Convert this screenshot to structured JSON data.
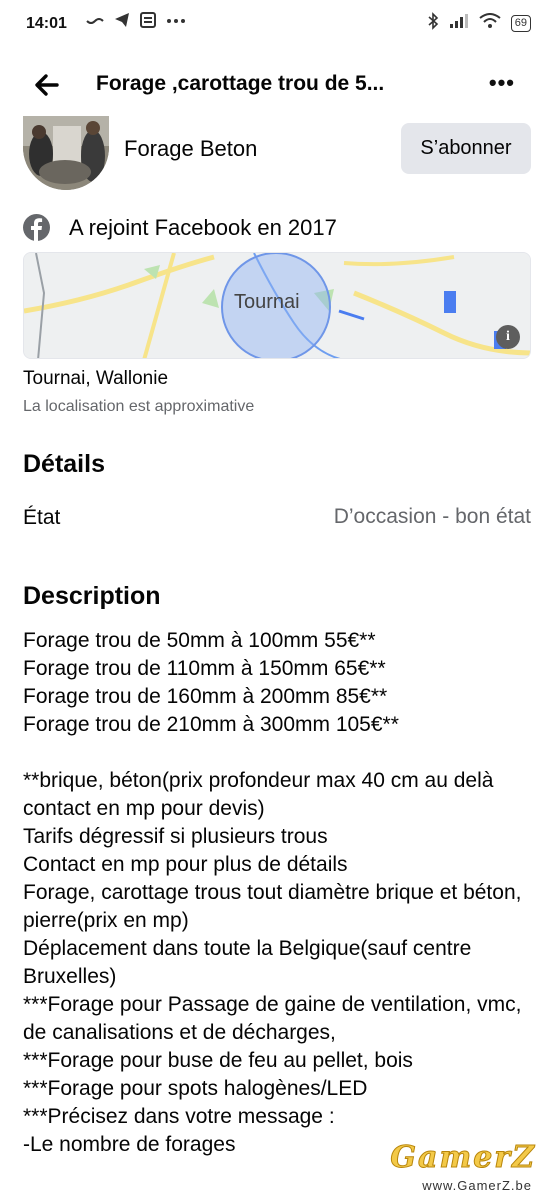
{
  "status_bar": {
    "time": "14:01",
    "battery": "69",
    "left_icons": [
      "wave-icon",
      "telegram-icon",
      "news-icon",
      "more-dots-icon"
    ],
    "right_icons": [
      "bluetooth-icon",
      "signal-icon",
      "wifi-icon",
      "battery-icon"
    ]
  },
  "header": {
    "title": "Forage ,carottage trou de 5...",
    "more_label": "•••"
  },
  "seller": {
    "name": "Forage Beton",
    "follow_label": "S’abonner"
  },
  "joined": "A rejoint Facebook en 2017",
  "map": {
    "city": "Tournai",
    "info_label": "i"
  },
  "location": {
    "name": "Tournai, Wallonie",
    "note": "La localisation est approximative"
  },
  "details": {
    "heading": "Détails",
    "condition_label": "État",
    "condition_value": "D’occasion - bon état"
  },
  "description": {
    "heading": "Description",
    "prices": [
      "Forage trou de 50mm à 100mm 55€**",
      "Forage trou de 110mm à 150mm 65€**",
      "Forage trou de 160mm à 200mm 85€**",
      "Forage trou de 210mm à 300mm 105€**"
    ],
    "notes": [
      "**brique, béton(prix profondeur max 40 cm au delà contact en mp pour devis)",
      "Tarifs dégressif si plusieurs trous",
      "Contact en mp pour plus de détails",
      "Forage, carottage trous tout diamètre brique et béton, pierre(prix en mp)",
      "Déplacement dans toute la Belgique(sauf centre Bruxelles)",
      "***Forage pour Passage de gaine de ventilation, vmc, de canalisations et de décharges,",
      "***Forage pour buse de feu au pellet, bois",
      "***Forage pour spots halogènes/LED",
      "***Précisez dans votre message :",
      "-Le nombre de forages"
    ]
  },
  "watermark": {
    "logo": "GamerZ",
    "url": "www.GamerZ.be"
  },
  "colors": {
    "text_primary": "#050505",
    "text_secondary": "#65676b",
    "button_bg": "#e4e6eb",
    "map_circle": "#8fb1f5",
    "map_road": "#f7e48a"
  }
}
